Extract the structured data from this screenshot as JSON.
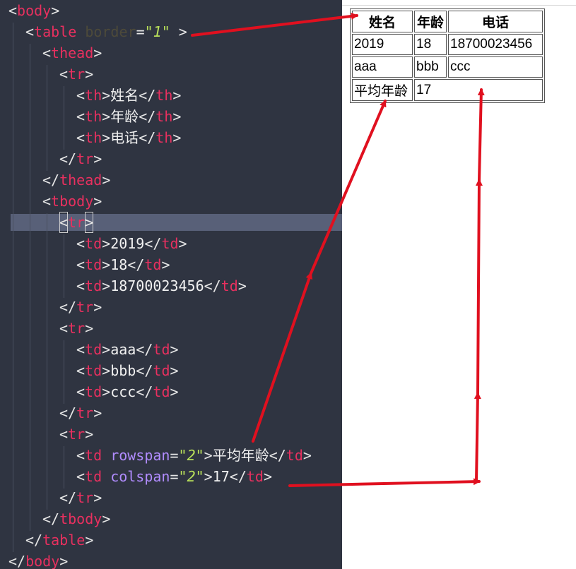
{
  "code": {
    "l1_tag": "body",
    "l2_tag": "table",
    "l2_attr": "border",
    "l2_val": "\"1\"",
    "l3_tag": "thead",
    "l4_tag": "tr",
    "th_tag": "th",
    "th1_text": "姓名",
    "th2_text": "年龄",
    "th3_text": "电话",
    "tbody_tag": "tbody",
    "td_tag": "td",
    "r1c1": "2019",
    "r1c2": "18",
    "r1c3": "18700023456",
    "r2c1": "aaa",
    "r2c2": "bbb",
    "r2c3": "ccc",
    "rowspan_attr": "rowspan",
    "rowspan_val": "\"2\"",
    "r3c1": "平均年龄",
    "colspan_attr": "colspan",
    "colspan_val": "\"2\"",
    "r3c2": "17"
  },
  "preview": {
    "headers": [
      "姓名",
      "年龄",
      "电话"
    ],
    "rows": [
      [
        "2019",
        "18",
        "18700023456"
      ],
      [
        "aaa",
        "bbb",
        "ccc"
      ],
      [
        "平均年龄",
        "17"
      ]
    ]
  },
  "colors": {
    "editor_bg": "#2f3441",
    "tag": "#e8305f",
    "attribute": "#b18cff",
    "string": "#b9e05a",
    "arrow": "#e0101f"
  }
}
